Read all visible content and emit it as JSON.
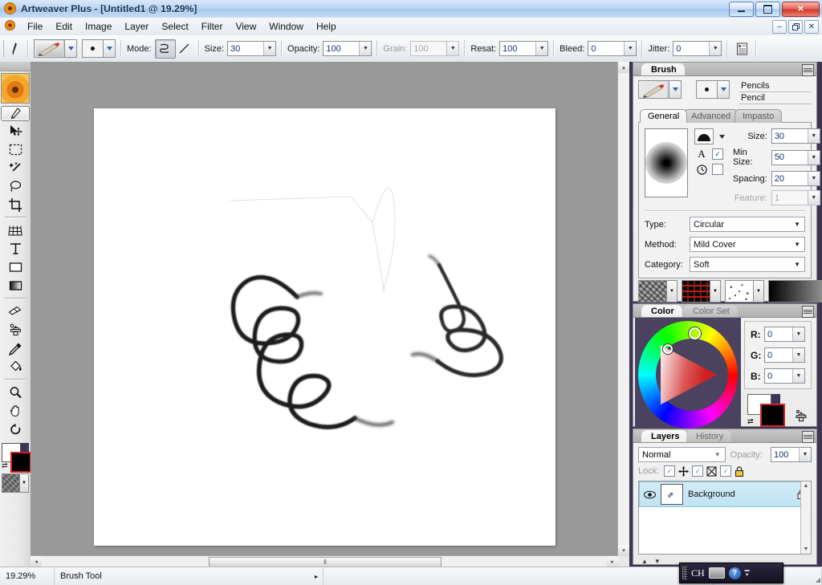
{
  "window": {
    "title": "Artweaver Plus - [Untitled1 @ 19.29%]",
    "app_icon": "sunflower-icon",
    "minimize_label": "─",
    "maximize_label": "❐",
    "close_label": "✕",
    "mdi_minimize_label": "–",
    "mdi_restore_label": "❐",
    "mdi_close_label": "✕"
  },
  "menubar": {
    "items": [
      {
        "label": "File"
      },
      {
        "label": "Edit"
      },
      {
        "label": "Image"
      },
      {
        "label": "Layer"
      },
      {
        "label": "Select"
      },
      {
        "label": "Filter"
      },
      {
        "label": "View"
      },
      {
        "label": "Window"
      },
      {
        "label": "Help"
      }
    ]
  },
  "options_toolbar": {
    "brush_preview_icon": "pencil-brush-icon",
    "dab_preview_icon": "round-dab-icon",
    "mode_label": "Mode:",
    "mode_freehand_icon": "freehand-squiggle-icon",
    "mode_line_icon": "straight-line-icon",
    "size_label": "Size:",
    "size_value": "30",
    "opacity_label": "Opacity:",
    "opacity_value": "100",
    "grain_label": "Grain:",
    "grain_value": "100",
    "grain_disabled": true,
    "resat_label": "Resat:",
    "resat_value": "100",
    "bleed_label": "Bleed:",
    "bleed_value": "0",
    "jitter_label": "Jitter:",
    "jitter_value": "0",
    "presets_icon": "brush-presets-icon"
  },
  "toolbox": {
    "image_thumb_icon": "sunflower-thumbnail-icon",
    "tools": [
      {
        "name": "brush-tool",
        "icon": "paintbrush-icon",
        "selected": true
      },
      {
        "name": "move-tool",
        "icon": "move-arrow-icon",
        "selected": false
      },
      {
        "name": "marquee-select-tool",
        "icon": "rectangular-marquee-icon",
        "selected": false
      },
      {
        "name": "magic-wand-tool",
        "icon": "magic-wand-icon",
        "selected": false
      },
      {
        "name": "lasso-tool",
        "icon": "lasso-icon",
        "selected": false
      },
      {
        "name": "crop-tool",
        "icon": "crop-icon",
        "selected": false
      },
      {
        "name": "perspective-grid-tool",
        "icon": "grid-perspective-icon",
        "selected": false
      },
      {
        "name": "text-tool",
        "icon": "text-T-icon",
        "selected": false
      },
      {
        "name": "shape-tool",
        "icon": "rectangle-shape-icon",
        "selected": false
      },
      {
        "name": "gradient-tool",
        "icon": "gradient-icon",
        "selected": false
      },
      {
        "name": "eraser-tool",
        "icon": "eraser-icon",
        "selected": false
      },
      {
        "name": "clone-stamp-tool",
        "icon": "clone-stamp-icon",
        "selected": false
      },
      {
        "name": "eyedropper-tool",
        "icon": "eyedropper-icon",
        "selected": false
      },
      {
        "name": "paint-bucket-tool",
        "icon": "paint-bucket-icon",
        "selected": false
      },
      {
        "name": "zoom-tool",
        "icon": "magnifier-icon",
        "selected": false
      },
      {
        "name": "hand-tool",
        "icon": "hand-icon",
        "selected": false
      },
      {
        "name": "rotate-canvas-tool",
        "icon": "rotate-arrow-icon",
        "selected": false
      }
    ],
    "foreground_color": "#000000",
    "background_color": "#ffffff",
    "swap_icon": "swap-colors-icon",
    "paper_texture_icon": "paper-texture-icon"
  },
  "document": {
    "background": "#999999",
    "canvas_color": "#ffffff",
    "artwork_description": "hand-drawn loopy pencil scribble strokes",
    "hscroll_thumb_icon": "horizontal-scroll-thumb",
    "scroll_left_icon": "◂",
    "scroll_right_icon": "▸",
    "scroll_up_icon": "▴",
    "scroll_down_icon": "▾"
  },
  "brush_panel": {
    "tab_label": "Brush",
    "menu_icon": "panel-menu-icon",
    "collapse_icon": "chevron-down-icon",
    "brush_preview_icon": "pencil-brush-icon",
    "dab_preview_icon": "round-dab-icon",
    "category_name": "Pencils",
    "variant_name": "Pencil",
    "subtabs": [
      {
        "label": "General",
        "active": true
      },
      {
        "label": "Advanced",
        "active": false
      },
      {
        "label": "Impasto",
        "active": false
      }
    ],
    "dab_shape_icon": "dab-shape-icon",
    "angle_icon": "angle-A-icon",
    "angle_checked": true,
    "timing_icon": "clock-icon",
    "timing_checked": false,
    "size_label": "Size:",
    "size_value": "30",
    "min_size_label": "Min Size:",
    "min_size_value": "50",
    "spacing_label": "Spacing:",
    "spacing_value": "20",
    "feature_label": "Feature:",
    "feature_value": "1",
    "feature_disabled": true,
    "type_label": "Type:",
    "type_value": "Circular",
    "method_label": "Method:",
    "method_value": "Mild Cover",
    "category_label": "Category:",
    "category_value": "Soft",
    "texture_pickers": [
      {
        "name": "paper-texture-picker",
        "icon": "paper-texture-icon"
      },
      {
        "name": "pattern-picker",
        "icon": "pattern-swatch-icon"
      },
      {
        "name": "nozzle-picker",
        "icon": "nozzle-swatch-icon"
      },
      {
        "name": "gradient-picker",
        "icon": "gradient-swatch-icon"
      }
    ]
  },
  "color_panel": {
    "tabs": [
      {
        "label": "Color",
        "active": true
      },
      {
        "label": "Color Set",
        "active": false
      }
    ],
    "menu_icon": "panel-menu-icon",
    "collapse_icon": "chevron-down-icon",
    "wheel_icon": "hue-color-wheel",
    "triangle_icon": "saturation-value-triangle",
    "r_label": "R:",
    "r_value": "0",
    "g_label": "G:",
    "g_value": "0",
    "b_label": "B:",
    "b_value": "0",
    "foreground_color": "#000000",
    "background_color": "#ffffff",
    "swap_icon": "swap-colors-icon",
    "eyedropper_icon": "color-picker-stamp-icon"
  },
  "layers_panel": {
    "tabs": [
      {
        "label": "Layers",
        "active": true
      },
      {
        "label": "History",
        "active": false
      }
    ],
    "menu_icon": "panel-menu-icon",
    "collapse_icon": "chevron-down-icon",
    "blend_mode": "Normal",
    "opacity_label": "Opacity:",
    "opacity_value": "100",
    "lock_label": "Lock:",
    "locks": [
      {
        "name": "lock-position",
        "icon": "move-cross-icon",
        "checked": true
      },
      {
        "name": "lock-transparency",
        "icon": "transparency-box-icon",
        "checked": true
      },
      {
        "name": "lock-all",
        "icon": "padlock-icon",
        "checked": true
      }
    ],
    "layers": [
      {
        "name": "Background",
        "visible": true,
        "visibility_icon": "eye-icon",
        "lock_icon": "padlock-icon",
        "thumbnail_icon": "layer-thumbnail",
        "selected": true
      }
    ],
    "scroll_up_icon": "▲",
    "scroll_down_icon": "▼",
    "bottom_buttons": [
      {
        "name": "layer-up-button",
        "icon": "▲"
      },
      {
        "name": "layer-down-button",
        "icon": "▼"
      }
    ]
  },
  "statusbar": {
    "zoom_value": "19.29%",
    "tool_name": "Brush Tool",
    "tool_menu_icon": "▸",
    "resize_grip_icon": "resize-grip-icon"
  },
  "ime_bar": {
    "grip_icon": "drag-grip-icon",
    "language": "CH",
    "keyboard_icon": "keyboard-icon",
    "help_icon": "help-question-icon",
    "expand_icon": "chevron-updown-icon"
  }
}
